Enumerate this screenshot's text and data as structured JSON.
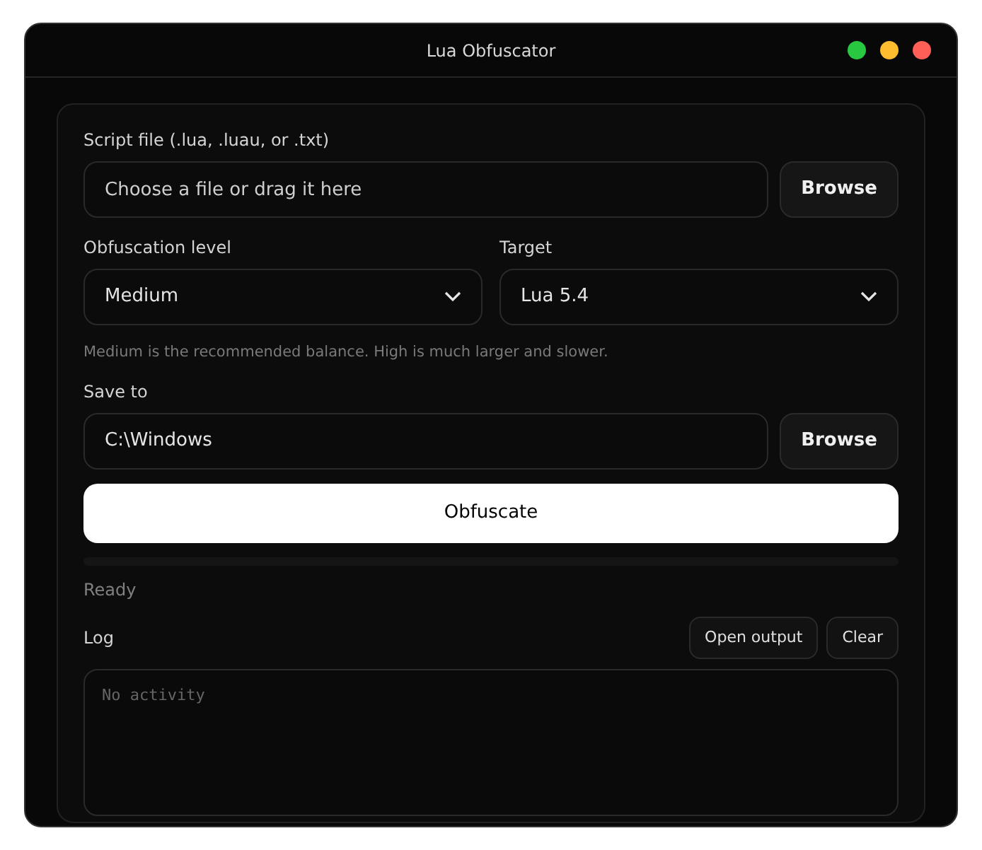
{
  "window": {
    "title": "Lua Obfuscator",
    "controls": [
      {
        "color": "#28c840"
      },
      {
        "color": "#febc2e"
      },
      {
        "color": "#ff5f57"
      }
    ]
  },
  "script_file": {
    "label": "Script file (.lua, .luau, or .txt)",
    "placeholder": "Choose a file or drag it here",
    "button": "Browse"
  },
  "selects": [
    {
      "label": "Obfuscation level",
      "value": "Medium"
    },
    {
      "label": "Target",
      "value": "Lua 5.4"
    }
  ],
  "hint": "Medium is the recommended balance. High is much larger and slower.",
  "save_to": {
    "label": "Save to",
    "value": "C:\\Windows",
    "button": "Browse"
  },
  "action": "Obfuscate",
  "progress": {
    "level": 0
  },
  "status": "Ready",
  "log": {
    "label": "Log",
    "buttons": [
      "Open output",
      "Clear"
    ],
    "placeholder": "No activity"
  }
}
